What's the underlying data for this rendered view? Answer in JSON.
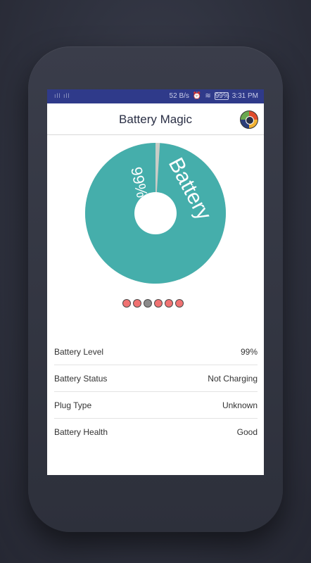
{
  "status_bar": {
    "signal": "ıll ıll",
    "speed": "52 B/s",
    "battery": "99%",
    "time": "3:31 PM"
  },
  "app": {
    "title": "Battery Magic"
  },
  "pie": {
    "percent_label": "99%",
    "name_label": "Battery",
    "level": 0.99,
    "colors": {
      "fill": "#45aeab",
      "rest": "#c9ccc6"
    }
  },
  "pager": {
    "count": 6,
    "active_index": 2
  },
  "info_rows": [
    {
      "label": "Battery Level",
      "value": "99%"
    },
    {
      "label": "Battery Status",
      "value": "Not Charging"
    },
    {
      "label": "Plug Type",
      "value": "Unknown"
    },
    {
      "label": "Battery Health",
      "value": "Good"
    }
  ]
}
